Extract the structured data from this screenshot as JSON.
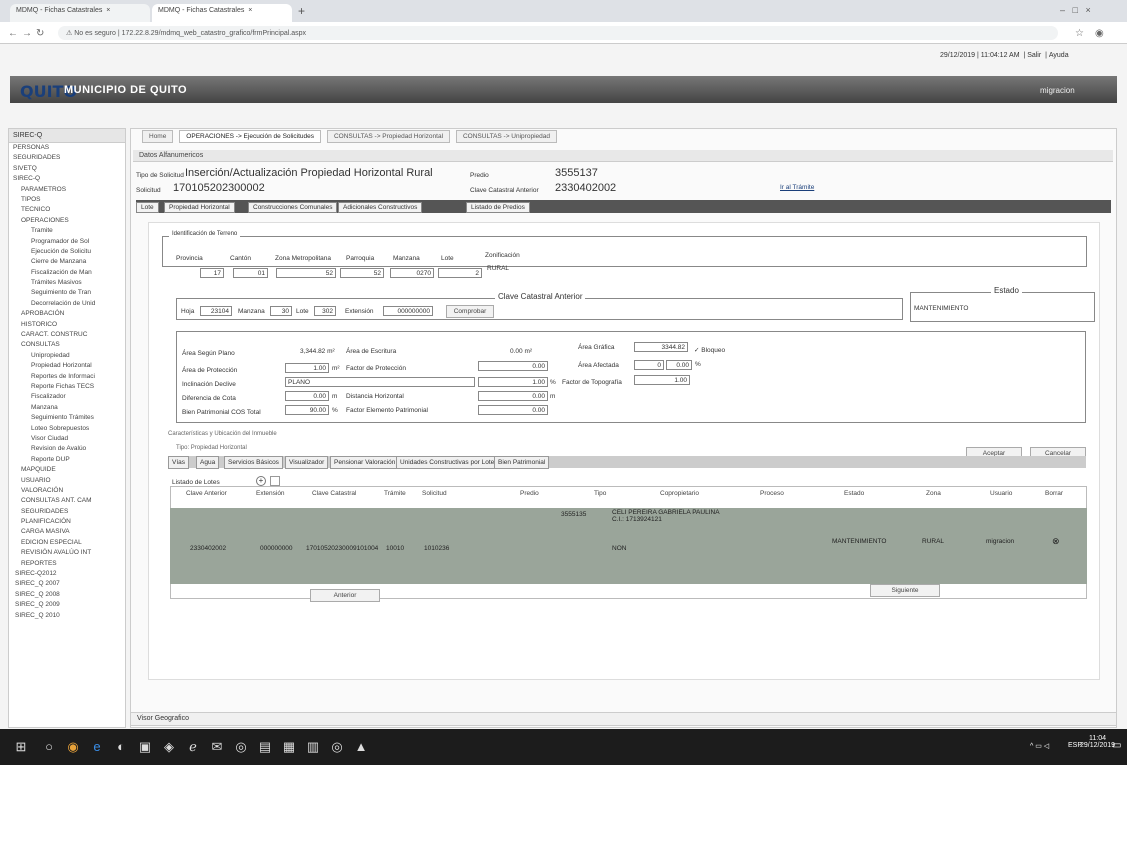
{
  "browser": {
    "tabs": [
      "MDMQ - Fichas Catastrales",
      "MDMQ - Fichas Catastrales"
    ],
    "new_tab": "+",
    "url_prefix": "No es seguro",
    "url": "172.22.8.29/mdmq_web_catastro_grafico/frmPrincipal.aspx"
  },
  "header": {
    "datetime": "29/12/2019 | 11:04:12 AM",
    "exit": "Salir",
    "help": "Ayuda",
    "logo": "QUITO",
    "municipality": "MUNICIPIO DE QUITO",
    "user": "migracion"
  },
  "sidebar": {
    "title": "SIREC-Q",
    "items": [
      "PERSONAS",
      "SEGURIDADES",
      "SIVETQ",
      "SIREC-Q",
      "PARAMETROS",
      "TIPOS",
      "TECNICO",
      "OPERACIONES",
      "Tramite",
      "Programador de Sol",
      "Ejecución de Solicitu",
      "Cierre de Manzana",
      "Fiscalización de Man",
      "Trámites Masivos",
      "Seguimiento de Tran",
      "Decorrelación de Unid",
      "APROBACIÓN",
      "HISTORICO",
      "CARACT. CONSTRUC",
      "CONSULTAS",
      "Unipropiedad",
      "Propiedad Horizontal",
      "Reportes de Informaci",
      "Reporte Fichas TECS",
      "Fiscalizador",
      "Manzana",
      "Seguimiento Trámites",
      "Loteo Sobrepuestos",
      "Visor Ciudad",
      "Revision de Avalúo",
      "Reporte DUP",
      "MAPQUIDE",
      "USUARIO",
      "VALORACIÓN",
      "CONSULTAS ANT. CAM",
      "SEGURIDADES",
      "PLANIFICACIÓN",
      "CARGA MASIVA",
      "EDICION ESPECIAL",
      "REVISIÓN AVALÚO INT",
      "REPORTES",
      "SIREC-Q2012",
      "SIREC_Q 2007",
      "SIREC_Q 2008",
      "SIREC_Q 2009",
      "SIREC_Q 2010"
    ]
  },
  "main_tabs": [
    "Home",
    "OPERACIONES -> Ejecución de Solicitudes",
    "CONSULTAS -> Propiedad Horizontal",
    "CONSULTAS -> Unipropiedad"
  ],
  "panel_title": "Datos Alfanumericos",
  "request": {
    "type_label": "Tipo de Solicitud",
    "type_value": "Inserción/Actualización Propiedad Horizontal Rural",
    "code_label": "Solicitud",
    "code_value": "170105202300002",
    "predio_label": "Predio",
    "predio_value": "3555137",
    "clave_label": "Clave Catastral Anterior",
    "clave_value": "2330402002",
    "tramite_link": "Ir al Trámite"
  },
  "sub_tabs": [
    "Lote",
    "Propiedad Horizontal",
    "Construcciones Comunales",
    "Adicionales Constructivos",
    "Listado de Predios"
  ],
  "ubicacion": {
    "legend": "Identificación de Terreno",
    "headers": [
      "Provincia",
      "Cantón",
      "Zona Metropolitana",
      "Parroquia",
      "Manzana",
      "Lote",
      "Zonificación"
    ],
    "values": [
      "17",
      "01",
      "52",
      "52",
      "0270",
      "2",
      "RURAL"
    ]
  },
  "clave_anterior": {
    "legend": "Clave Catastral Anterior",
    "hoja_label": "Hoja",
    "hoja": "23104",
    "manzana_label": "Manzana",
    "manzana": "30",
    "lote_label": "Lote",
    "lote": "302",
    "extension_label": "Extensión",
    "extension": "000000000",
    "button": "Comprobar"
  },
  "estado": {
    "legend": "Estado",
    "value": "MANTENIMIENTO"
  },
  "areas": {
    "area_plano_label": "Área Según Plano",
    "area_plano": "3,344.82",
    "unit_m2": "m²",
    "area_escritura_label": "Área de Escritura",
    "area_escritura": "0.00",
    "area_grafica_label": "Área Gráfica",
    "area_grafica": "3344.82",
    "bloqueo": "Bloqueo",
    "area_proteccion_label": "Área de Protección",
    "area_proteccion": "1.00",
    "factor_proteccion_label": "Factor de Protección",
    "factor_proteccion": "0.00",
    "area_afectada_label": "Área Afectada",
    "area_afectada": "0",
    "area_afectada_pct": "0.00",
    "inclinacion_label": "Inclinación Declive",
    "inclinacion": "PLANO",
    "factor_topo_label": "Factor de Topografía",
    "factor_topo": "1.00",
    "pct1": "1.00",
    "diferencia_label": "Diferencia de Cota",
    "diferencia": "0.00",
    "unit_m": "m",
    "dist_label": "Distancia Horizontal",
    "dist": "0.00",
    "bien_label": "Bien Patrimonial COS Total",
    "bien": "90.00",
    "pct_sign": "%",
    "factor_patr_label": "Factor Elemento Patrimonial",
    "factor_patr": "0.00"
  },
  "caracteristicas_label": "Características y Ubicación del Inmueble",
  "tipo_label": "Tipo: Propiedad Horizontal",
  "buttons": {
    "aceptar": "Aceptar",
    "cancelar": "Cancelar"
  },
  "sec_tabs": [
    "Vías",
    "Agua",
    "Servicios Básicos",
    "Visualizador",
    "Pensionar Valoración",
    "Unidades Constructivas por Lote",
    "Bien Patrimonial"
  ],
  "listado_label": "Listado de Lotes",
  "table": {
    "headers": [
      "Clave Anterior",
      "Extensión",
      "Clave Catastral",
      "Trámite",
      "Solicitud",
      "Predio",
      "Tipo",
      "Copropietario",
      "Proceso",
      "Estado",
      "Zona",
      "Usuario",
      "Borrar"
    ],
    "row": {
      "clave_anterior": "2330402002",
      "extension": "000000000",
      "clave_catastral": "17010520230009101004",
      "tramite": "10010",
      "solicitud": "1010236",
      "predio": "3555135",
      "tipo": "NON",
      "copropietario": "CELI PEREIRA GABRIELA PAULINA C.I.: 1713924121",
      "estado": "MANTENIMIENTO",
      "zona": "RURAL",
      "usuario": "migracion",
      "borrar": "⊗"
    },
    "prev": "Anterior",
    "next": "Siguiente"
  },
  "viewer": "Visor Geografico",
  "taskbar": {
    "time": "11:04",
    "date": "29/12/2019",
    "lang": "ESP"
  }
}
